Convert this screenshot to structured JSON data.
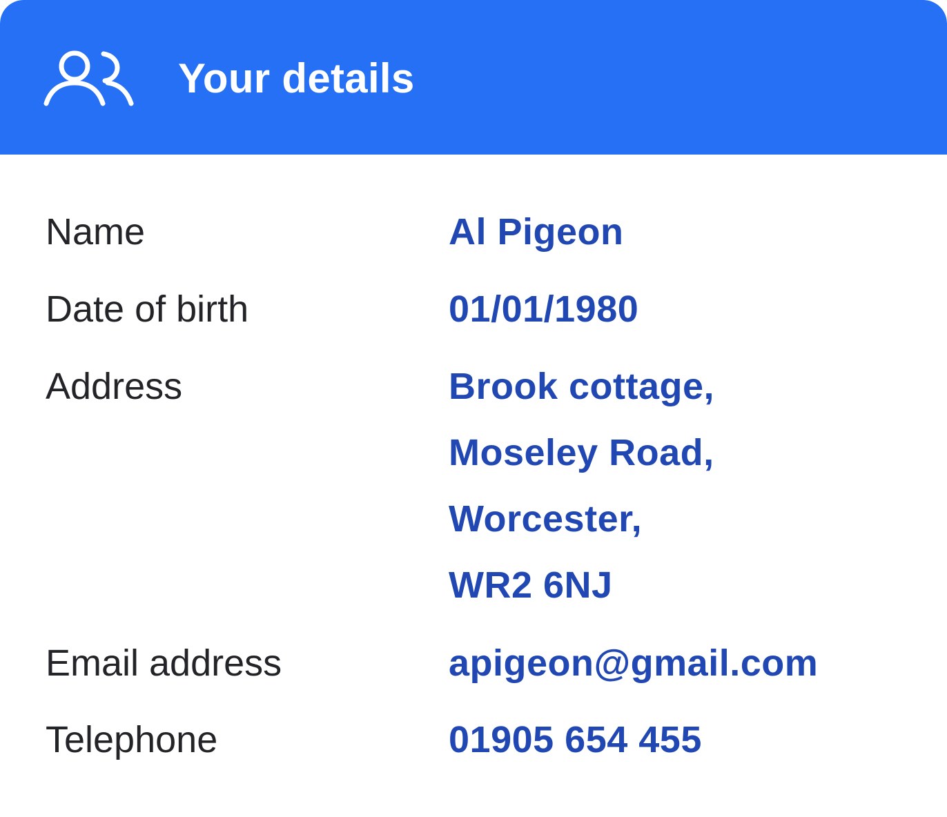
{
  "header": {
    "title": "Your details",
    "icon": "users-icon",
    "background_color": "#2570F4"
  },
  "details": [
    {
      "label": "Name",
      "value_lines": [
        "Al Pigeon"
      ]
    },
    {
      "label": "Date of birth",
      "value_lines": [
        "01/01/1980"
      ]
    },
    {
      "label": "Address",
      "value_lines": [
        "Brook cottage,",
        "Moseley Road,",
        "Worcester,",
        "WR2 6NJ"
      ]
    },
    {
      "label": "Email address",
      "value_lines": [
        "apigeon@gmail.com"
      ]
    },
    {
      "label": "Telephone",
      "value_lines": [
        "01905 654 455"
      ]
    }
  ],
  "colors": {
    "label_text": "#222428",
    "value_text": "#2147B3"
  }
}
